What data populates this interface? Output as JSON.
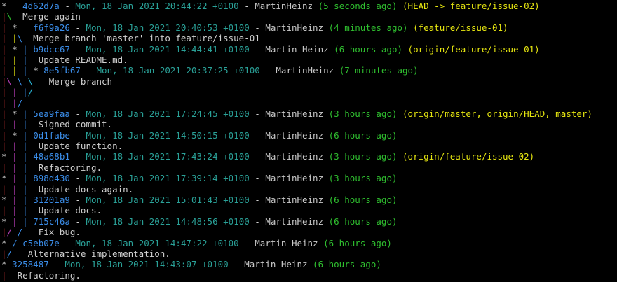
{
  "colors": {
    "fg": "#d0d0d0",
    "hash": "#3b8eea",
    "date": "#2aa198",
    "author": "#c8c8c8",
    "rel": "#2fbf2f",
    "ref": "#e5e510",
    "g_red": "#cd3131",
    "g_green": "#2fbf2f",
    "g_yellow": "#e5e510",
    "g_blue": "#3b8eea",
    "g_magenta": "#bc3fbc",
    "g_cyan": "#29b8db"
  },
  "lines": [
    {
      "segs": [
        [
          "* ",
          "fg"
        ],
        [
          "  ",
          "fg"
        ],
        [
          "4d62d7a",
          "hash"
        ],
        [
          " - ",
          "fg"
        ],
        [
          "Mon, 18 Jan 2021 20:44:22 +0100",
          "date"
        ],
        [
          " - ",
          "fg"
        ],
        [
          "MartinHeinz",
          "author"
        ],
        [
          " ",
          "fg"
        ],
        [
          "(5 seconds ago)",
          "rel"
        ],
        [
          " ",
          "fg"
        ],
        [
          "(HEAD -> feature/issue-02)",
          "ref"
        ]
      ]
    },
    {
      "segs": [
        [
          "|",
          "g_red"
        ],
        [
          "\\",
          "g_green"
        ],
        [
          "  Merge again",
          "fg"
        ]
      ]
    },
    {
      "segs": [
        [
          "| ",
          "g_red"
        ],
        [
          "* ",
          "fg"
        ],
        [
          "  ",
          "fg"
        ],
        [
          "f6f9a26",
          "hash"
        ],
        [
          " - ",
          "fg"
        ],
        [
          "Mon, 18 Jan 2021 20:40:53 +0100",
          "date"
        ],
        [
          " - ",
          "fg"
        ],
        [
          "MartinHeinz",
          "author"
        ],
        [
          " ",
          "fg"
        ],
        [
          "(4 minutes ago)",
          "rel"
        ],
        [
          " ",
          "fg"
        ],
        [
          "(feature/issue-01)",
          "ref"
        ]
      ]
    },
    {
      "segs": [
        [
          "| ",
          "g_red"
        ],
        [
          "|",
          "g_yellow"
        ],
        [
          "\\",
          "g_blue"
        ],
        [
          "  Merge branch 'master' into feature/issue-01",
          "fg"
        ]
      ]
    },
    {
      "segs": [
        [
          "| ",
          "g_red"
        ],
        [
          "* ",
          "fg"
        ],
        [
          "| ",
          "g_blue"
        ],
        [
          "b9dcc67",
          "hash"
        ],
        [
          " - ",
          "fg"
        ],
        [
          "Mon, 18 Jan 2021 14:44:41 +0100",
          "date"
        ],
        [
          " - ",
          "fg"
        ],
        [
          "Martin Heinz",
          "author"
        ],
        [
          " ",
          "fg"
        ],
        [
          "(6 hours ago)",
          "rel"
        ],
        [
          " ",
          "fg"
        ],
        [
          "(origin/feature/issue-01)",
          "ref"
        ]
      ]
    },
    {
      "segs": [
        [
          "| ",
          "g_red"
        ],
        [
          "| ",
          "g_yellow"
        ],
        [
          "| ",
          "g_blue"
        ],
        [
          " Update README.md.",
          "fg"
        ]
      ]
    },
    {
      "segs": [
        [
          "| ",
          "g_red"
        ],
        [
          "| ",
          "g_yellow"
        ],
        [
          "| ",
          "g_blue"
        ],
        [
          "* ",
          "fg"
        ],
        [
          "8e5fb67",
          "hash"
        ],
        [
          " - ",
          "fg"
        ],
        [
          "Mon, 18 Jan 2021 20:37:25 +0100",
          "date"
        ],
        [
          " - ",
          "fg"
        ],
        [
          "MartinHeinz",
          "author"
        ],
        [
          " ",
          "fg"
        ],
        [
          "(7 minutes ago)",
          "rel"
        ]
      ]
    },
    {
      "segs": [
        [
          "|",
          "g_red"
        ],
        [
          "\\ ",
          "g_magenta"
        ],
        [
          "\\ ",
          "g_blue"
        ],
        [
          "\\ ",
          "g_cyan"
        ],
        [
          "  Merge branch",
          "fg"
        ]
      ]
    },
    {
      "segs": [
        [
          "| ",
          "g_red"
        ],
        [
          "| ",
          "g_magenta"
        ],
        [
          "|",
          "g_blue"
        ],
        [
          "/",
          "g_cyan"
        ]
      ]
    },
    {
      "segs": [
        [
          "| ",
          "g_red"
        ],
        [
          "|",
          "g_magenta"
        ],
        [
          "/",
          "g_blue"
        ]
      ]
    },
    {
      "segs": [
        [
          "| ",
          "g_red"
        ],
        [
          "* ",
          "fg"
        ],
        [
          "| ",
          "g_blue"
        ],
        [
          "5ea9faa",
          "hash"
        ],
        [
          " - ",
          "fg"
        ],
        [
          "Mon, 18 Jan 2021 17:24:45 +0100",
          "date"
        ],
        [
          " - ",
          "fg"
        ],
        [
          "MartinHeinz",
          "author"
        ],
        [
          " ",
          "fg"
        ],
        [
          "(3 hours ago)",
          "rel"
        ],
        [
          " ",
          "fg"
        ],
        [
          "(origin/master, origin/HEAD, master)",
          "ref"
        ]
      ]
    },
    {
      "segs": [
        [
          "| ",
          "g_red"
        ],
        [
          "| ",
          "g_magenta"
        ],
        [
          "| ",
          "g_blue"
        ],
        [
          " Signed commit.",
          "fg"
        ]
      ]
    },
    {
      "segs": [
        [
          "| ",
          "g_red"
        ],
        [
          "* ",
          "fg"
        ],
        [
          "| ",
          "g_blue"
        ],
        [
          "0d1fabe",
          "hash"
        ],
        [
          " - ",
          "fg"
        ],
        [
          "Mon, 18 Jan 2021 14:50:15 +0100",
          "date"
        ],
        [
          " - ",
          "fg"
        ],
        [
          "MartinHeinz",
          "author"
        ],
        [
          " ",
          "fg"
        ],
        [
          "(6 hours ago)",
          "rel"
        ]
      ]
    },
    {
      "segs": [
        [
          "| ",
          "g_red"
        ],
        [
          "| ",
          "g_magenta"
        ],
        [
          "| ",
          "g_blue"
        ],
        [
          " Update function.",
          "fg"
        ]
      ]
    },
    {
      "segs": [
        [
          "* ",
          "fg"
        ],
        [
          "| ",
          "g_magenta"
        ],
        [
          "| ",
          "g_blue"
        ],
        [
          "48a68b1",
          "hash"
        ],
        [
          " - ",
          "fg"
        ],
        [
          "Mon, 18 Jan 2021 17:43:24 +0100",
          "date"
        ],
        [
          " - ",
          "fg"
        ],
        [
          "MartinHeinz",
          "author"
        ],
        [
          " ",
          "fg"
        ],
        [
          "(3 hours ago)",
          "rel"
        ],
        [
          " ",
          "fg"
        ],
        [
          "(origin/feature/issue-02)",
          "ref"
        ]
      ]
    },
    {
      "segs": [
        [
          "| ",
          "g_red"
        ],
        [
          "| ",
          "g_magenta"
        ],
        [
          "| ",
          "g_blue"
        ],
        [
          " Refactoring.",
          "fg"
        ]
      ]
    },
    {
      "segs": [
        [
          "* ",
          "fg"
        ],
        [
          "| ",
          "g_magenta"
        ],
        [
          "| ",
          "g_blue"
        ],
        [
          "898d430",
          "hash"
        ],
        [
          " - ",
          "fg"
        ],
        [
          "Mon, 18 Jan 2021 17:39:14 +0100",
          "date"
        ],
        [
          " - ",
          "fg"
        ],
        [
          "MartinHeinz",
          "author"
        ],
        [
          " ",
          "fg"
        ],
        [
          "(3 hours ago)",
          "rel"
        ]
      ]
    },
    {
      "segs": [
        [
          "| ",
          "g_red"
        ],
        [
          "| ",
          "g_magenta"
        ],
        [
          "| ",
          "g_blue"
        ],
        [
          " Update docs again.",
          "fg"
        ]
      ]
    },
    {
      "segs": [
        [
          "* ",
          "fg"
        ],
        [
          "| ",
          "g_magenta"
        ],
        [
          "| ",
          "g_blue"
        ],
        [
          "31201a9",
          "hash"
        ],
        [
          " - ",
          "fg"
        ],
        [
          "Mon, 18 Jan 2021 15:01:43 +0100",
          "date"
        ],
        [
          " - ",
          "fg"
        ],
        [
          "MartinHeinz",
          "author"
        ],
        [
          " ",
          "fg"
        ],
        [
          "(6 hours ago)",
          "rel"
        ]
      ]
    },
    {
      "segs": [
        [
          "| ",
          "g_red"
        ],
        [
          "| ",
          "g_magenta"
        ],
        [
          "| ",
          "g_blue"
        ],
        [
          " Update docs.",
          "fg"
        ]
      ]
    },
    {
      "segs": [
        [
          "* ",
          "fg"
        ],
        [
          "| ",
          "g_magenta"
        ],
        [
          "| ",
          "g_blue"
        ],
        [
          "715c46a",
          "hash"
        ],
        [
          " - ",
          "fg"
        ],
        [
          "Mon, 18 Jan 2021 14:48:56 +0100",
          "date"
        ],
        [
          " - ",
          "fg"
        ],
        [
          "MartinHeinz",
          "author"
        ],
        [
          " ",
          "fg"
        ],
        [
          "(6 hours ago)",
          "rel"
        ]
      ]
    },
    {
      "segs": [
        [
          "|",
          "g_red"
        ],
        [
          "/ ",
          "g_magenta"
        ],
        [
          "/ ",
          "g_blue"
        ],
        [
          "  Fix bug.",
          "fg"
        ]
      ]
    },
    {
      "segs": [
        [
          "* ",
          "fg"
        ],
        [
          "/ ",
          "g_blue"
        ],
        [
          "c5eb07e",
          "hash"
        ],
        [
          " - ",
          "fg"
        ],
        [
          "Mon, 18 Jan 2021 14:47:22 +0100",
          "date"
        ],
        [
          " - ",
          "fg"
        ],
        [
          "Martin Heinz",
          "author"
        ],
        [
          " ",
          "fg"
        ],
        [
          "(6 hours ago)",
          "rel"
        ]
      ]
    },
    {
      "segs": [
        [
          "|",
          "g_red"
        ],
        [
          "/ ",
          "g_blue"
        ],
        [
          "  Alternative implementation.",
          "fg"
        ]
      ]
    },
    {
      "segs": [
        [
          "* ",
          "fg"
        ],
        [
          "3258487",
          "hash"
        ],
        [
          " - ",
          "fg"
        ],
        [
          "Mon, 18 Jan 2021 14:43:07 +0100",
          "date"
        ],
        [
          " - ",
          "fg"
        ],
        [
          "Martin Heinz",
          "author"
        ],
        [
          " ",
          "fg"
        ],
        [
          "(6 hours ago)",
          "rel"
        ]
      ]
    },
    {
      "segs": [
        [
          "|",
          "g_red"
        ],
        [
          "  Refactoring.",
          "fg"
        ]
      ]
    }
  ]
}
